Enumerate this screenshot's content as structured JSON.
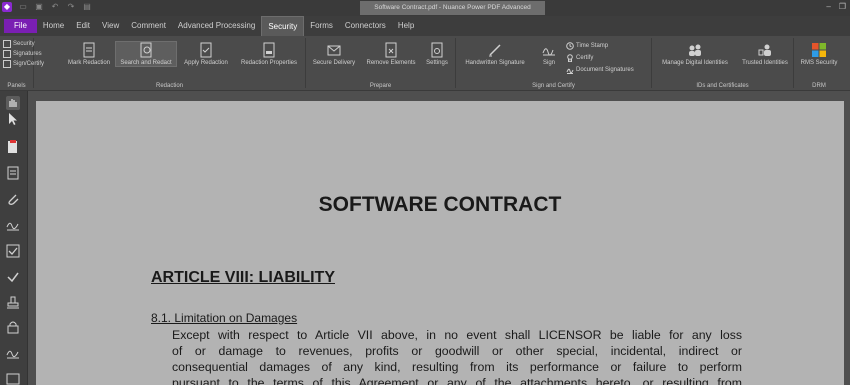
{
  "window": {
    "title": "Software Contract.pdf - Nuance Power PDF Advanced"
  },
  "menu": {
    "file": "File",
    "tabs": [
      "Home",
      "Edit",
      "View",
      "Comment",
      "Advanced Processing",
      "Security",
      "Forms",
      "Connectors",
      "Help"
    ],
    "active": "Security"
  },
  "ribbon": {
    "panels": {
      "label": "Panels",
      "items": [
        "Security",
        "Signatures",
        "Sign/Certify"
      ]
    },
    "redaction": {
      "label": "Redaction",
      "buttons": [
        "Mark Redaction",
        "Search and Redact",
        "Apply Redaction",
        "Redaction Properties"
      ]
    },
    "prepare": {
      "label": "Prepare",
      "buttons": [
        "Secure Delivery",
        "Remove Elements",
        "Settings"
      ]
    },
    "sign_certify": {
      "label": "Sign and Certify",
      "buttons": [
        "Handwritten Signature",
        "Sign"
      ],
      "small": [
        "Time Stamp",
        "Certify",
        "Document Signatures"
      ]
    },
    "ids": {
      "label": "IDs and Certificates",
      "buttons": [
        "Manage Digital Identities",
        "Trusted Identities"
      ]
    },
    "drm": {
      "label": "DRM",
      "buttons": [
        "RMS Security"
      ]
    }
  },
  "document": {
    "title": "SOFTWARE CONTRACT",
    "article": "ARTICLE VIII: LIABILITY",
    "section": "8.1. Limitation on Damages",
    "lines": [
      "Except with respect to Article VII above, in no event shall LICENSOR be liable for any loss",
      "of or damage to revenues, profits or goodwill or other special, incidental, indirect or",
      "consequential damages of any kind, resulting from its performance or failure to perform",
      "pursuant to the terms of this Agreement or any of the attachments hereto, or resulting from"
    ]
  },
  "colors": {
    "brand_purple": "#7a1fb3",
    "ribbon_bg": "#4b4b4b",
    "page_bg": "#b3b3b3"
  }
}
